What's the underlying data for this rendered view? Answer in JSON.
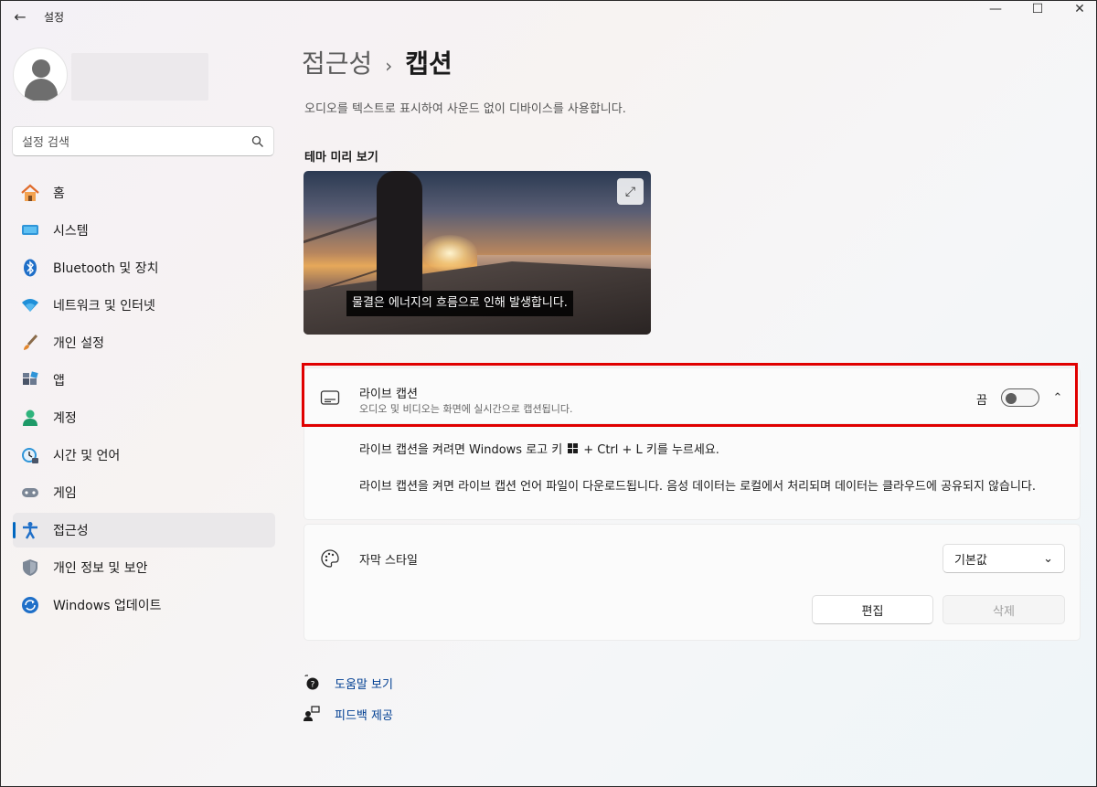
{
  "window": {
    "app_title": "설정",
    "minimize_glyph": "—",
    "maximize_glyph": "☐",
    "close_glyph": "✕",
    "back_glyph": "←"
  },
  "sidebar": {
    "search_placeholder": "설정 검색",
    "items": [
      {
        "label": "홈",
        "icon": "home-icon"
      },
      {
        "label": "시스템",
        "icon": "system-icon"
      },
      {
        "label": "Bluetooth 및 장치",
        "icon": "bluetooth-icon"
      },
      {
        "label": "네트워크 및 인터넷",
        "icon": "wifi-icon"
      },
      {
        "label": "개인 설정",
        "icon": "brush-icon"
      },
      {
        "label": "앱",
        "icon": "apps-icon"
      },
      {
        "label": "계정",
        "icon": "account-icon"
      },
      {
        "label": "시간 및 언어",
        "icon": "time-language-icon"
      },
      {
        "label": "게임",
        "icon": "gamepad-icon"
      },
      {
        "label": "접근성",
        "icon": "accessibility-icon",
        "selected": true
      },
      {
        "label": "개인 정보 및 보안",
        "icon": "shield-icon"
      },
      {
        "label": "Windows 업데이트",
        "icon": "update-icon"
      }
    ]
  },
  "main": {
    "breadcrumb_parent": "접근성",
    "breadcrumb_sep": "›",
    "breadcrumb_current": "캡션",
    "description": "오디오를 텍스트로 표시하여 사운드 없이 디바이스를 사용합니다.",
    "preview_label": "테마 미리 보기",
    "preview_caption": "물결은 에너지의 흐름으로 인해 발생합니다.",
    "expand_glyph": "⤢",
    "live_captions": {
      "title": "라이브 캡션",
      "subtitle": "오디오 및 비디오는 화면에 실시간으로 캡션됩니다.",
      "toggle_state": "끔",
      "toggle_on": false,
      "chevron": "⌃",
      "info_line1_prefix": "라이브 캡션을 켜려면 Windows 로고 키",
      "info_line1_suffix": "+ Ctrl + L 키를 누르세요.",
      "info_line2": "라이브 캡션을 켜면 라이브 캡션 언어 파일이 다운로드됩니다. 음성 데이터는 로컬에서 처리되며 데이터는 클라우드에 공유되지 않습니다."
    },
    "caption_style": {
      "label": "자막 스타일",
      "selected": "기본값",
      "dropdown_glyph": "⌄",
      "edit_label": "편집",
      "delete_label": "삭제"
    },
    "links": {
      "help": "도움말 보기",
      "feedback": "피드백 제공"
    }
  },
  "colors": {
    "accent": "#0067c0",
    "highlight": "#e00000",
    "link": "#003e92"
  }
}
